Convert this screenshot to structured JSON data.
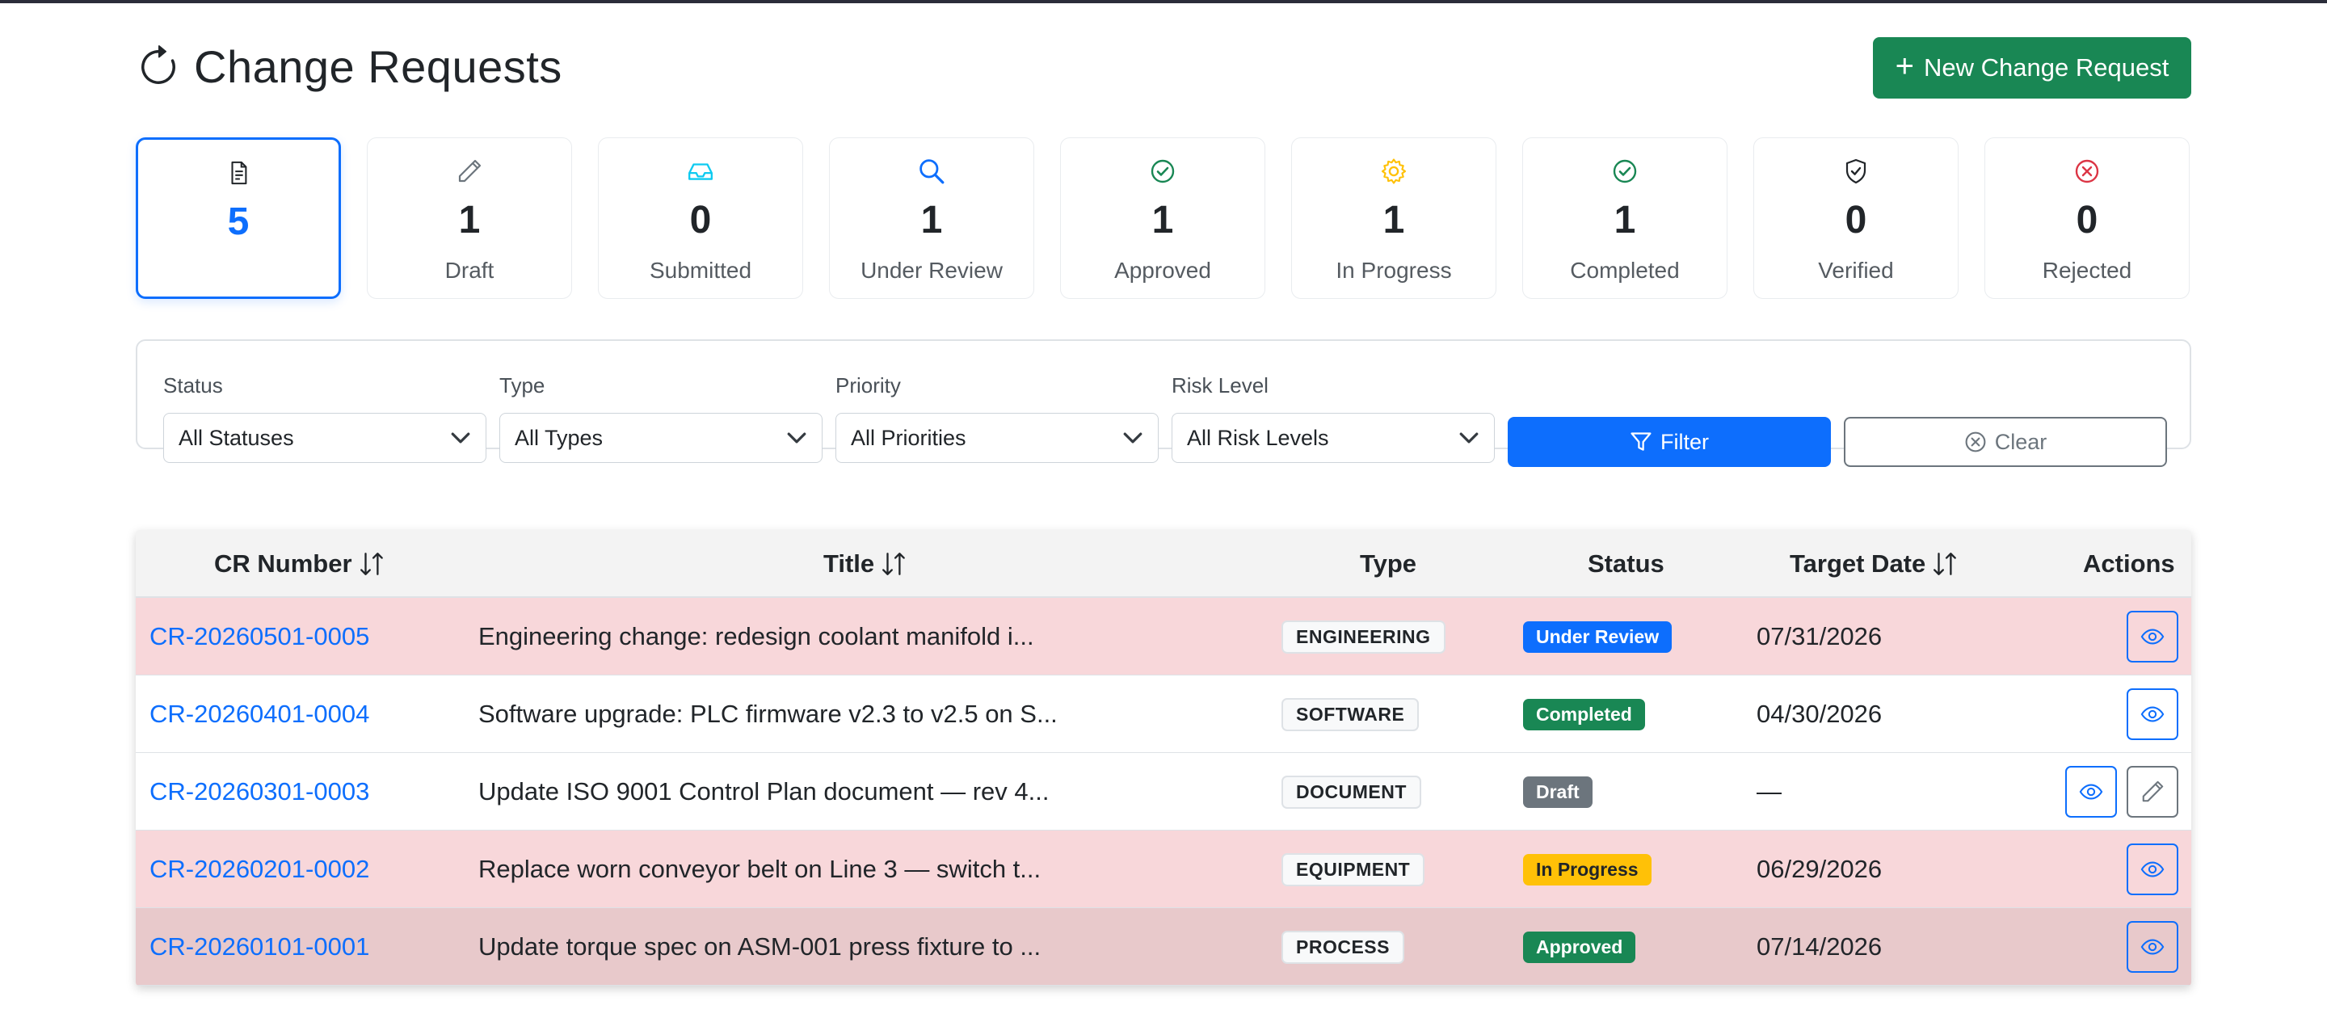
{
  "header": {
    "title": "Change Requests",
    "title_icon": "refresh-icon",
    "new_button_label": "New Change Request"
  },
  "stats": [
    {
      "name": "all",
      "icon": "document-icon",
      "value": "5",
      "label": "",
      "color": "#212529",
      "active": true
    },
    {
      "name": "draft",
      "icon": "pencil-icon",
      "value": "1",
      "label": "Draft",
      "color": "#6c757d"
    },
    {
      "name": "submitted",
      "icon": "inbox-icon",
      "value": "0",
      "label": "Submitted",
      "color": "#0dcaf0"
    },
    {
      "name": "under-review",
      "icon": "search-icon",
      "value": "1",
      "label": "Under Review",
      "color": "#0d6efd"
    },
    {
      "name": "approved",
      "icon": "check-circle-icon",
      "value": "1",
      "label": "Approved",
      "color": "#198754"
    },
    {
      "name": "in-progress",
      "icon": "gear-icon",
      "value": "1",
      "label": "In Progress",
      "color": "#ffc107"
    },
    {
      "name": "completed",
      "icon": "check-circle-icon",
      "value": "1",
      "label": "Completed",
      "color": "#198754"
    },
    {
      "name": "verified",
      "icon": "shield-check-icon",
      "value": "0",
      "label": "Verified",
      "color": "#212529"
    },
    {
      "name": "rejected",
      "icon": "x-circle-icon",
      "value": "0",
      "label": "Rejected",
      "color": "#dc3545"
    }
  ],
  "filters": {
    "status": {
      "label": "Status",
      "value": "All Statuses"
    },
    "type": {
      "label": "Type",
      "value": "All Types"
    },
    "priority": {
      "label": "Priority",
      "value": "All Priorities"
    },
    "risk": {
      "label": "Risk Level",
      "value": "All Risk Levels"
    },
    "filter_button": "Filter",
    "clear_button": "Clear"
  },
  "table": {
    "columns": {
      "cr_number": "CR Number",
      "title": "Title",
      "type": "Type",
      "status": "Status",
      "target_date": "Target Date",
      "actions": "Actions"
    },
    "rows": [
      {
        "cr": "CR-20260501-0005",
        "title": "Engineering change: redesign coolant manifold i...",
        "type": "ENGINEERING",
        "status": "Under Review",
        "status_color": "#0d6efd",
        "status_text_color": "#ffffff",
        "date": "07/31/2026",
        "row_style": "pink",
        "editable": false
      },
      {
        "cr": "CR-20260401-0004",
        "title": "Software upgrade: PLC firmware v2.3 to v2.5 on S...",
        "type": "SOFTWARE",
        "status": "Completed",
        "status_color": "#198754",
        "status_text_color": "#ffffff",
        "date": "04/30/2026",
        "row_style": "white",
        "editable": false
      },
      {
        "cr": "CR-20260301-0003",
        "title": "Update ISO 9001 Control Plan document — rev 4...",
        "type": "DOCUMENT",
        "status": "Draft",
        "status_color": "#6c757d",
        "status_text_color": "#ffffff",
        "date": "—",
        "row_style": "white",
        "editable": true
      },
      {
        "cr": "CR-20260201-0002",
        "title": "Replace worn conveyor belt on Line 3 — switch t...",
        "type": "EQUIPMENT",
        "status": "In Progress",
        "status_color": "#ffc107",
        "status_text_color": "#212529",
        "date": "06/29/2026",
        "row_style": "pink",
        "editable": false
      },
      {
        "cr": "CR-20260101-0001",
        "title": "Update torque spec on ASM-001 press fixture to ...",
        "type": "PROCESS",
        "status": "Approved",
        "status_color": "#198754",
        "status_text_color": "#ffffff",
        "date": "07/14/2026",
        "row_style": "pink-dark",
        "editable": false
      }
    ]
  }
}
